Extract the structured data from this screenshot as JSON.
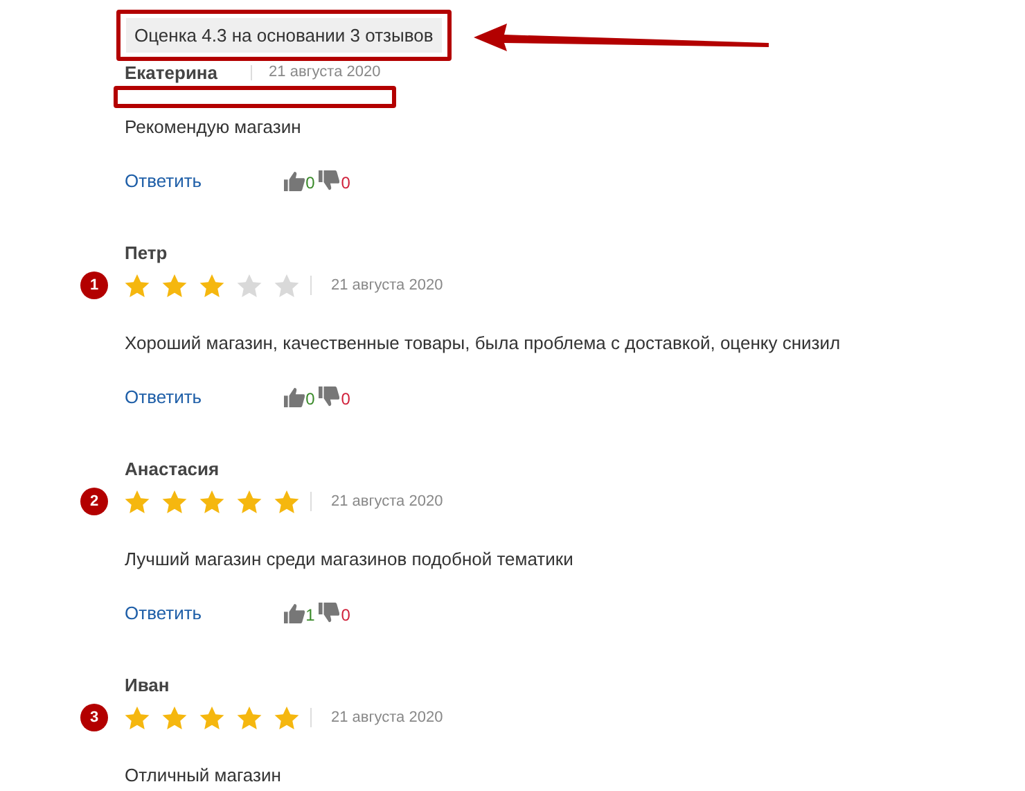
{
  "summary": {
    "text": "Оценка 4.3 на основании 3 отзывов",
    "highlighted": true
  },
  "reviews": [
    {
      "kind": "highlighted",
      "name": "Екатерина",
      "date": "21 августа 2020",
      "text": "Рекомендую магазин",
      "reply": "Ответить",
      "likes": "0",
      "dislikes": "0"
    },
    {
      "kind": "rated",
      "badge": "1",
      "name": "Петр",
      "stars": 3,
      "date": "21 августа 2020",
      "text": "Хороший магазин, качественные товары, была проблема с доставкой, оценку снизил",
      "reply": "Ответить",
      "likes": "0",
      "dislikes": "0"
    },
    {
      "kind": "rated",
      "badge": "2",
      "name": "Анастасия",
      "stars": 5,
      "date": "21 августа 2020",
      "text": "Лучший магазин среди магазинов подобной тематики",
      "reply": "Ответить",
      "likes": "1",
      "dislikes": "0"
    },
    {
      "kind": "rated",
      "badge": "3",
      "name": "Иван",
      "stars": 5,
      "date": "21 августа 2020",
      "text": "Отличный магазин"
    }
  ]
}
